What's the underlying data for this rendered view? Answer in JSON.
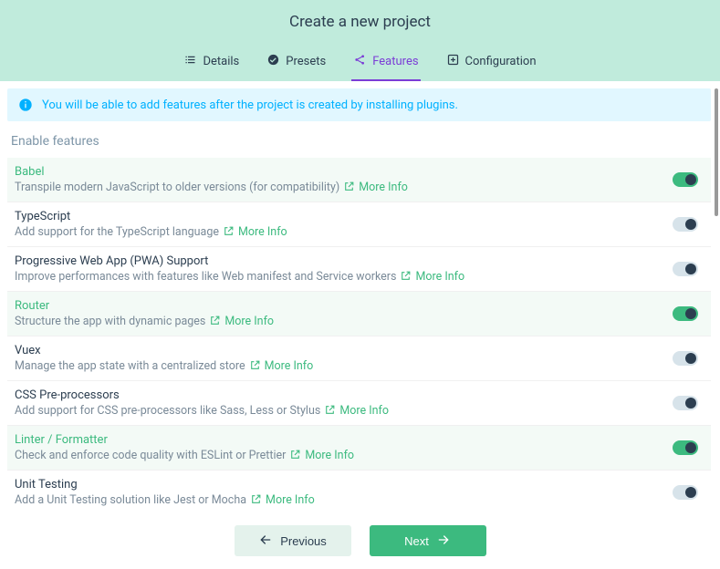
{
  "header": {
    "title": "Create a new project",
    "tabs": [
      {
        "label": "Details"
      },
      {
        "label": "Presets"
      },
      {
        "label": "Features",
        "active": true
      },
      {
        "label": "Configuration"
      }
    ]
  },
  "notice": "You will be able to add features after the project is created by installing plugins.",
  "section_title": "Enable features",
  "more_info_label": "More Info",
  "features": [
    {
      "name": "Babel",
      "desc": "Transpile modern JavaScript to older versions (for compatibility)",
      "on": true
    },
    {
      "name": "TypeScript",
      "desc": "Add support for the TypeScript language",
      "on": false
    },
    {
      "name": "Progressive Web App (PWA) Support",
      "desc": "Improve performances with features like Web manifest and Service workers",
      "on": false
    },
    {
      "name": "Router",
      "desc": "Structure the app with dynamic pages",
      "on": true
    },
    {
      "name": "Vuex",
      "desc": "Manage the app state with a centralized store",
      "on": false
    },
    {
      "name": "CSS Pre-processors",
      "desc": "Add support for CSS pre-processors like Sass, Less or Stylus",
      "on": false
    },
    {
      "name": "Linter / Formatter",
      "desc": "Check and enforce code quality with ESLint or Prettier",
      "on": true
    },
    {
      "name": "Unit Testing",
      "desc": "Add a Unit Testing solution like Jest or Mocha",
      "on": false
    }
  ],
  "footer": {
    "prev": "Previous",
    "next": "Next"
  }
}
